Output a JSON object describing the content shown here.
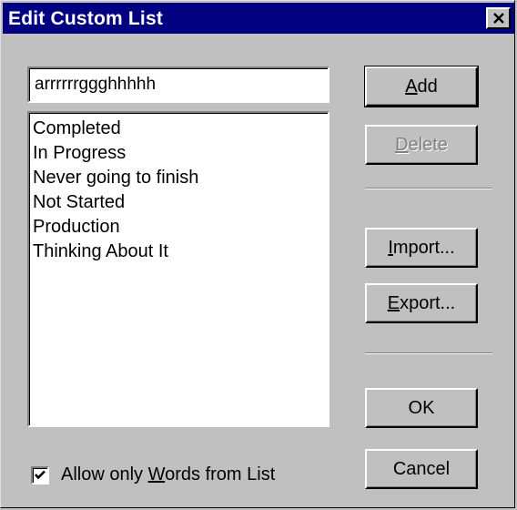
{
  "window": {
    "title": "Edit Custom List",
    "close_icon": "close-icon"
  },
  "entry": {
    "value": "arrrrrrggghhhhh"
  },
  "list": {
    "items": [
      "Completed",
      "In Progress",
      "Never going to finish",
      "Not Started",
      "Production",
      "Thinking About It"
    ]
  },
  "buttons": {
    "add": {
      "mnemonic": "A",
      "rest": "dd"
    },
    "delete": {
      "mnemonic": "D",
      "rest": "elete",
      "enabled": false
    },
    "import": {
      "mnemonic": "I",
      "rest": "mport..."
    },
    "export": {
      "mnemonic": "E",
      "rest": "xport..."
    },
    "ok": {
      "label": "OK"
    },
    "cancel": {
      "label": "Cancel"
    }
  },
  "option": {
    "checked": true,
    "label_before": "Allow only ",
    "label_mnemonic": "W",
    "label_after": "ords from List"
  },
  "colors": {
    "titlebar": "#000080",
    "face": "#c0c0c0",
    "disabled_text": "#808080"
  }
}
